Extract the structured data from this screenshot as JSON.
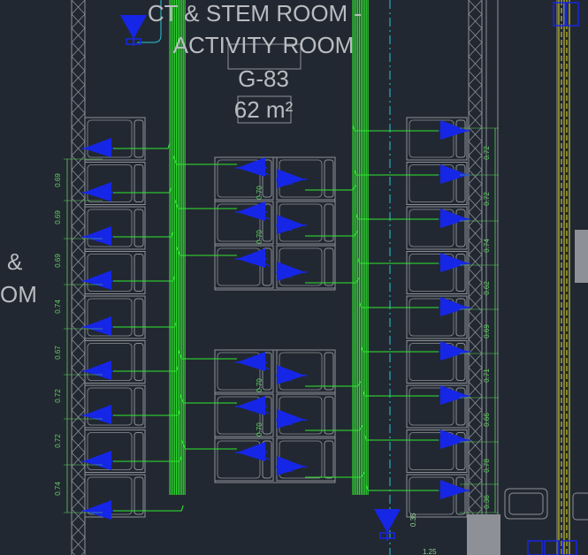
{
  "drawing": {
    "room_name_line1": "CT & STEM ROOM -",
    "room_name_line2": "ACTIVITY ROOM",
    "room_number": "G-83",
    "room_area": "62 m²",
    "side_room_fragment_1": "&",
    "side_room_fragment_2": "OM"
  },
  "dimensions": {
    "left_column": [
      "0.69",
      "0.69",
      "0.69",
      "0.74",
      "0.67",
      "0.72",
      "0.72",
      "0.74"
    ],
    "right_column": [
      "0.72",
      "0.72",
      "0.74",
      "0.62",
      "0.69",
      "0.71",
      "0.66",
      "0.78",
      "0.36"
    ],
    "center_upper": [
      "0.70",
      "0.70"
    ],
    "center_lower": [
      "0.70",
      "0.70"
    ],
    "bottom_vertical": "0.35",
    "bottom_horizontal": "1.25"
  },
  "colors": {
    "background": "#222831",
    "cable_green": "#2ee82e",
    "symbol_blue": "#1626e6",
    "furniture_gray": "#8d9096",
    "dimension_green": "#5fd35f",
    "cyan_line": "#22c8d8",
    "yellow_line": "#e6e02a"
  },
  "icons": [
    "desk-power-outlet-symbol-icon",
    "floor-box-triangle-icon",
    "lattice-column-icon"
  ]
}
